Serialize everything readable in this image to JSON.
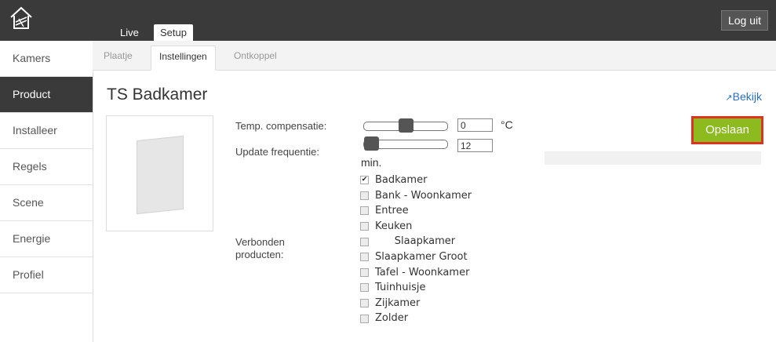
{
  "header": {
    "tabs": [
      {
        "label": "Live"
      },
      {
        "label": "Setup"
      }
    ],
    "logout_label": "Log uit"
  },
  "sidebar": {
    "items": [
      {
        "label": "Kamers"
      },
      {
        "label": "Product"
      },
      {
        "label": "Installeer"
      },
      {
        "label": "Regels"
      },
      {
        "label": "Scene"
      },
      {
        "label": "Energie"
      },
      {
        "label": "Profiel"
      }
    ],
    "active": "Product"
  },
  "subtabs": [
    {
      "label": "Plaatje"
    },
    {
      "label": "Instellingen"
    },
    {
      "label": "Ontkoppel"
    }
  ],
  "page": {
    "title": "TS Badkamer",
    "bekijk_label": "Bekijk",
    "save_label": "Opslaan"
  },
  "settings": {
    "temp_label": "Temp. compensatie:",
    "temp_value": "0",
    "temp_unit": "°C",
    "temp_slider_level": 0.5,
    "update_label": "Update frequentie:",
    "update_value": "12",
    "update_unit": "min.",
    "update_slider_level": 0.0,
    "linked_label": "Verbonden producten:"
  },
  "linked_products": [
    {
      "label": "Badkamer",
      "checked": true
    },
    {
      "label": "Bank - Woonkamer",
      "checked": false
    },
    {
      "label": "Entree",
      "checked": false
    },
    {
      "label": "Keuken",
      "checked": false
    },
    {
      "label": "      Slaapkamer",
      "checked": false
    },
    {
      "label": "Slaapkamer Groot",
      "checked": false
    },
    {
      "label": "Tafel - Woonkamer",
      "checked": false
    },
    {
      "label": "Tuinhuisje",
      "checked": false
    },
    {
      "label": "Zijkamer",
      "checked": false
    },
    {
      "label": "Zolder",
      "checked": false
    }
  ],
  "colors": {
    "topbar": "#3a3a3a",
    "save_button": "#8cba1f",
    "save_border": "#dd3322",
    "link": "#2a6ebb"
  }
}
